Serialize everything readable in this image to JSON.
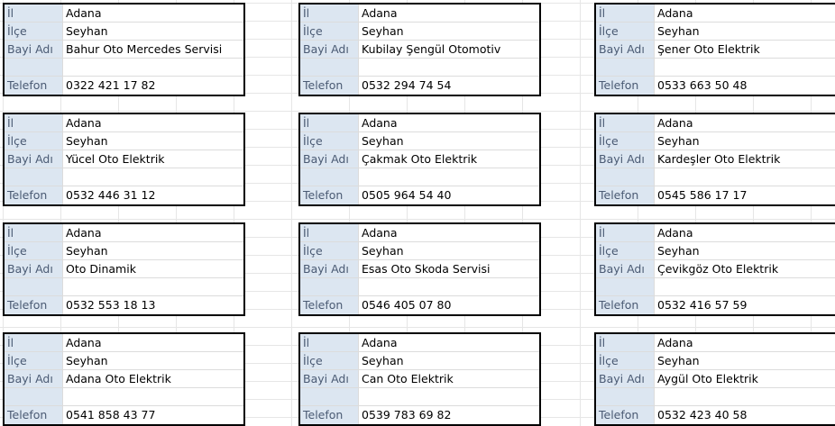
{
  "labels": {
    "il": "İl",
    "ilce": "İlçe",
    "bayi": "Bayi Adı",
    "telefon": "Telefon"
  },
  "cards": [
    {
      "il": "Adana",
      "ilce": "Seyhan",
      "bayi": "Bahur Oto Mercedes Servisi",
      "telefon": "0322 421 17 82"
    },
    {
      "il": "Adana",
      "ilce": "Seyhan",
      "bayi": "Kubilay Şengül Otomotiv",
      "telefon": "0532 294 74 54"
    },
    {
      "il": "Adana",
      "ilce": "Seyhan",
      "bayi": "Şener Oto Elektrik",
      "telefon": "0533 663 50 48"
    },
    {
      "il": "Adana",
      "ilce": "Seyhan",
      "bayi": "Yücel Oto Elektrik",
      "telefon": "0532 446 31 12"
    },
    {
      "il": "Adana",
      "ilce": "Seyhan",
      "bayi": "Çakmak Oto Elektrik",
      "telefon": "0505 964 54 40"
    },
    {
      "il": "Adana",
      "ilce": "Seyhan",
      "bayi": "Kardeşler Oto Elektrik",
      "telefon": "0545 586 17 17"
    },
    {
      "il": "Adana",
      "ilce": "Seyhan",
      "bayi": "Oto Dinamik",
      "telefon": "0532 553 18 13"
    },
    {
      "il": "Adana",
      "ilce": "Seyhan",
      "bayi": "Esas Oto Skoda Servisi",
      "telefon": "0546 405 07 80"
    },
    {
      "il": "Adana",
      "ilce": "Seyhan",
      "bayi": "Çevikgöz Oto Elektrik",
      "telefon": "0532 416 57 59"
    },
    {
      "il": "Adana",
      "ilce": "Seyhan",
      "bayi": "Adana Oto Elektrik",
      "telefon": "0541 858 43 77"
    },
    {
      "il": "Adana",
      "ilce": "Seyhan",
      "bayi": "Can Oto Elektrik",
      "telefon": "0539 783 69 82"
    },
    {
      "il": "Adana",
      "ilce": "Seyhan",
      "bayi": "Aygül Oto Elektrik",
      "telefon": "0532 423 40 58"
    }
  ]
}
